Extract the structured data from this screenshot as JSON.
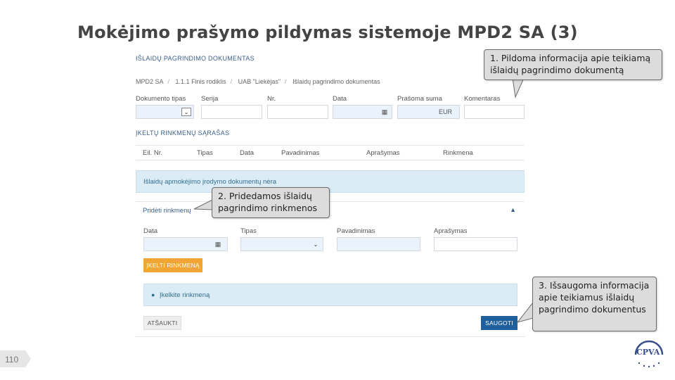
{
  "slide": {
    "title": "Mokėjimo prašymo pildymas sistemoje MPD2 SA (3)",
    "page_number": "110",
    "logo_text": "CPVA"
  },
  "form": {
    "section_title": "IŠLAIDŲ PAGRINDIMO DOKUMENTAS",
    "breadcrumb": [
      "MPD2 SA",
      "1.1.1 Finis rodiklis",
      "UAB \"Liekėjas\"",
      "Išlaidų pagrindimo dokumentas"
    ],
    "labels": {
      "doc_type": "Dokumento tipas",
      "series": "Serija",
      "number": "Nr.",
      "date": "Data",
      "amount": "Prašoma suma",
      "comment": "Komentaras"
    },
    "currency": "EUR",
    "icons": {
      "calendar": "▦",
      "dropdown": "⌄"
    }
  },
  "files": {
    "section_title": "ĮKELTŲ RINKMENŲ SĄRAŠAS",
    "columns": [
      "Eil. Nr.",
      "Tipas",
      "Data",
      "Pavadinimas",
      "Aprašymas",
      "Rinkmena"
    ],
    "empty_message": "Išlaidų apmokėjimo įrodymo dokumentų nėra"
  },
  "add_file": {
    "title": "Pridėti rinkmenų",
    "collapse_icon": "▲",
    "labels": {
      "date": "Data",
      "type": "Tipas",
      "name": "Pavadinimas",
      "description": "Aprašymas"
    },
    "upload_button": "ĮKELTI RINKMENĄ",
    "info_icon": "●",
    "info_message": "Įkelkite rinkmeną"
  },
  "actions": {
    "cancel": "ATŠAUKTI",
    "save": "SAUGOTI"
  },
  "callouts": {
    "c1": "1. Pildoma informacija apie teikiamą išlaidų pagrindimo dokumentą",
    "c2": "2. Pridedamos išlaidų pagrindimo rinkmenos",
    "c3": "3. Išsaugoma informacija apie teikiamus išlaidų pagrindimo dokumentus"
  },
  "colors": {
    "accent_blue": "#1f5f9b",
    "upload_orange": "#f0a534",
    "info_bg": "#dcecf6",
    "callout_bg": "#dcdcdc"
  }
}
